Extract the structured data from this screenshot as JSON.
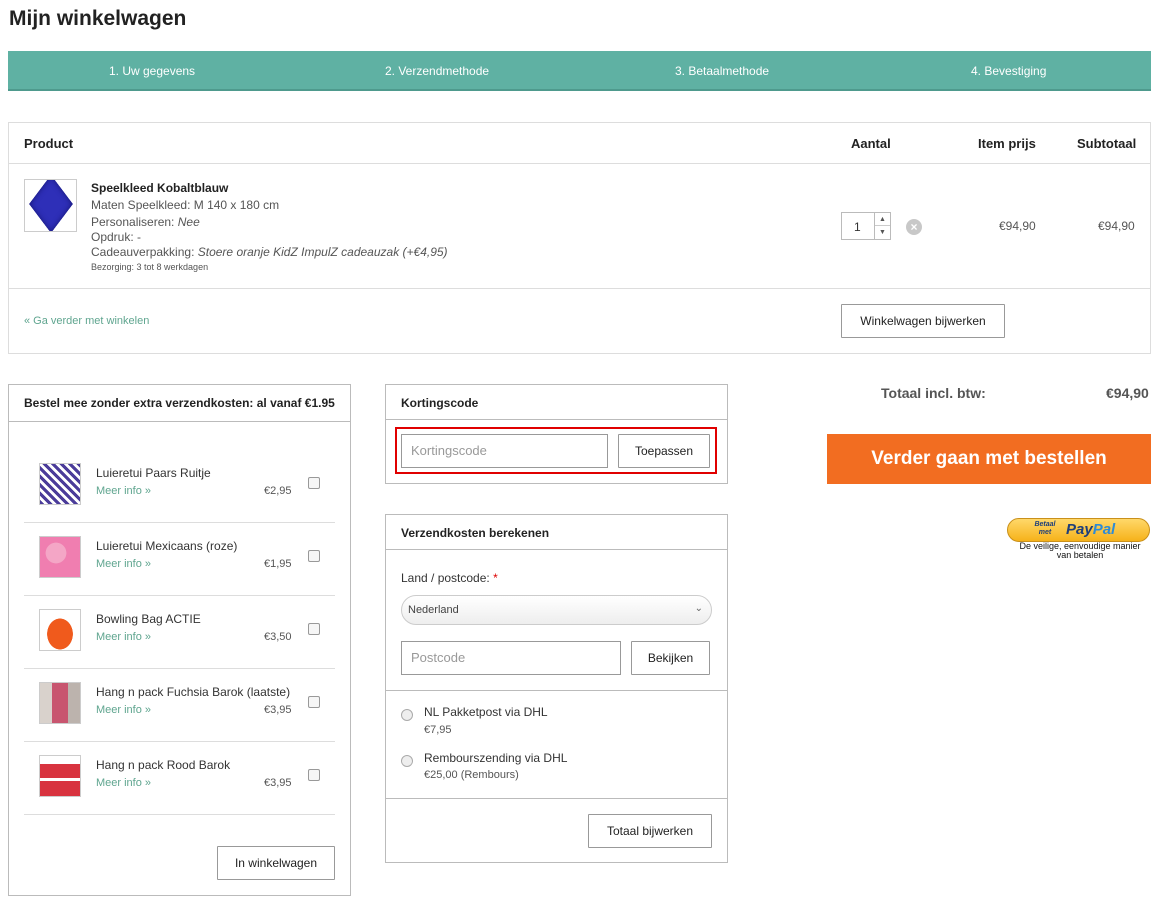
{
  "page": {
    "title": "Mijn winkelwagen"
  },
  "steps": [
    "1.   Uw gegevens",
    "2.   Verzendmethode",
    "3.   Betaalmethode",
    "4.   Bevestiging"
  ],
  "cart": {
    "headers": {
      "product": "Product",
      "qty": "Aantal",
      "item_price": "Item prijs",
      "subtotal": "Subtotaal"
    },
    "item": {
      "name": "Speelkleed Kobaltblauw",
      "size": "Maten Speelkleed: M 140 x 180 cm",
      "personalize_label": "Personaliseren:",
      "personalize_value": "Nee",
      "print": "Opdruk: -",
      "gift_label": "Cadeauverpakking:",
      "gift_value": "Stoere oranje KidZ ImpulZ cadeauzak (+€4,95)",
      "delivery": "Bezorging: 3 tot 8 werkdagen",
      "quantity": "1",
      "item_price": "€94,90",
      "subtotal": "€94,90"
    },
    "continue_link": "« Ga verder met winkelen",
    "update_button": "Winkelwagen bijwerken"
  },
  "upsell": {
    "title": "Bestel mee zonder extra verzendkosten: al vanaf €1.95",
    "more_label": "Meer info »",
    "items": [
      {
        "name": "Luieretui Paars Ruitje",
        "price": "€2,95"
      },
      {
        "name": "Luieretui Mexicaans (roze)",
        "price": "€1,95"
      },
      {
        "name": "Bowling Bag ACTIE",
        "price": "€3,50"
      },
      {
        "name": "Hang n pack Fuchsia Barok (laatste)",
        "price": "€3,95"
      },
      {
        "name": "Hang n pack Rood Barok",
        "price": "€3,95"
      }
    ],
    "add_button": "In winkelwagen"
  },
  "coupon": {
    "title": "Kortingscode",
    "placeholder": "Kortingscode",
    "apply_button": "Toepassen"
  },
  "shipping": {
    "title": "Verzendkosten berekenen",
    "country_label": "Land / postcode:",
    "required_mark": "*",
    "country_value": "Nederland",
    "postcode_placeholder": "Postcode",
    "view_button": "Bekijken",
    "options": [
      {
        "name": "NL Pakketpost via DHL",
        "price": "€7,95"
      },
      {
        "name": "Rembourszending via DHL",
        "price": "€25,00 (Rembours)"
      }
    ],
    "update_button": "Totaal bijwerken"
  },
  "totals": {
    "label": "Totaal incl. btw:",
    "value": "€94,90"
  },
  "checkout": {
    "label": "Verder gaan met bestellen"
  },
  "paypal": {
    "small": "Betaal met",
    "logo_pay": "Pay",
    "logo_pal": "Pal",
    "caption": "De veilige, eenvoudige manier van betalen"
  },
  "colors": {
    "steps_bg": "#5fb1a3",
    "checkout_bg": "#f26d21",
    "link": "#5fa58f",
    "highlight": "#e00000"
  }
}
